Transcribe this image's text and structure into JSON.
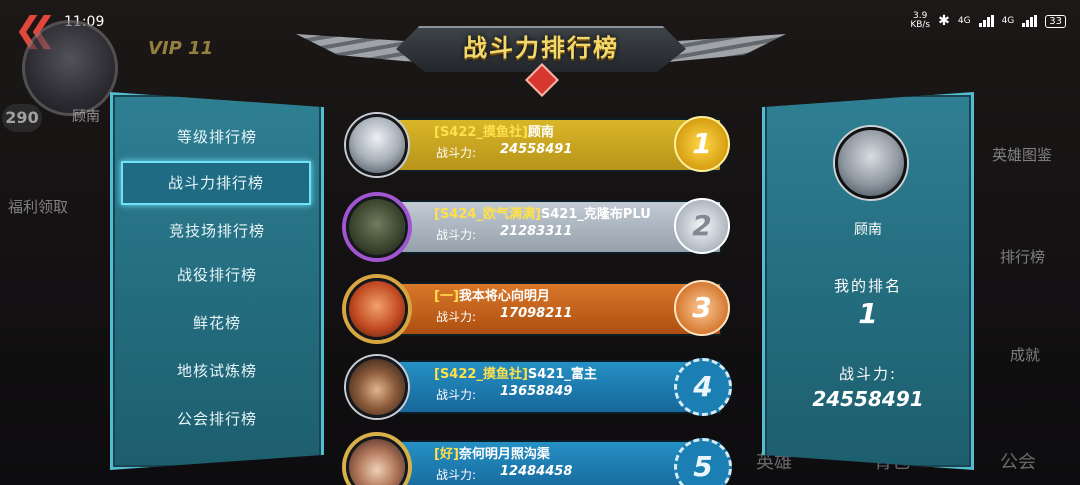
{
  "status_bar": {
    "time": "11:09",
    "net_speed": "3.9",
    "net_unit": "KB/s",
    "signal1": "4G",
    "signal2": "4G",
    "battery": "33"
  },
  "background": {
    "vip": "VIP 11",
    "level": "290",
    "player_name": "顾南",
    "welfare": "福利领取",
    "hero_guide": "英雄图鉴",
    "leaderboard": "排行榜",
    "achievement": "成就",
    "hero": "英雄",
    "bag": "背包",
    "guild": "公会"
  },
  "title": "战斗力排行榜",
  "categories": [
    {
      "label": "等级排行榜"
    },
    {
      "label": "战斗力排行榜"
    },
    {
      "label": "竞技场排行榜"
    },
    {
      "label": "战役排行榜"
    },
    {
      "label": "鲜花榜"
    },
    {
      "label": "地核试炼榜"
    },
    {
      "label": "公会排行榜"
    }
  ],
  "active_category": 1,
  "power_label": "战斗力:",
  "rankings": [
    {
      "rank": "1",
      "tag": "[S422_摸鱼社]",
      "name": "顾南",
      "power": "24558491",
      "bar_color": "#c8a51f",
      "badge_color": "#e0b21b"
    },
    {
      "rank": "2",
      "tag": "[S424_欧气满满]",
      "name": "S421_克隆布PLU",
      "power": "21283311",
      "bar_color": "#aab4bf",
      "badge_color": "#cfd6dd"
    },
    {
      "rank": "3",
      "tag": "[一]",
      "name": "我本将心向明月",
      "power": "17098211",
      "bar_color": "#c4631a",
      "badge_color": "#d9803b"
    },
    {
      "rank": "4",
      "tag": "[S422_摸鱼社]",
      "name": "S421_富主",
      "power": "13658849",
      "bar_color": "#1f7fb0",
      "badge_color": "#2a8fc4"
    },
    {
      "rank": "5",
      "tag": "[好]",
      "name": "奈何明月照沟渠",
      "power": "12484458",
      "bar_color": "#1f7fb0",
      "badge_color": "#2a8fc4"
    }
  ],
  "profile": {
    "name": "顾南",
    "my_rank_label": "我的排名",
    "my_rank": "1",
    "power_label": "战斗力:",
    "power": "24558491"
  }
}
